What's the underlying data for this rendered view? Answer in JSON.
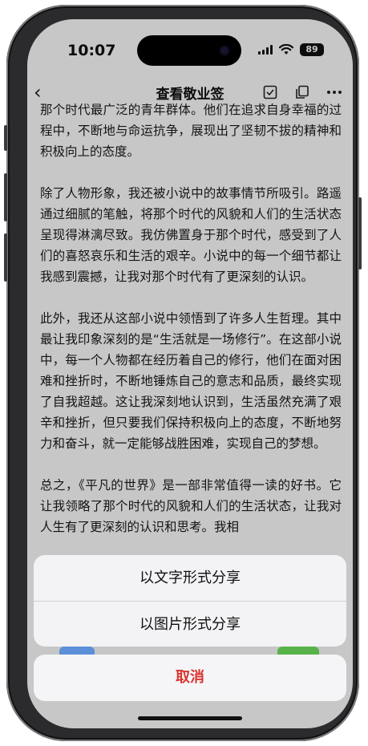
{
  "status_bar": {
    "time": "10:07",
    "battery": "89"
  },
  "nav": {
    "back_glyph": "‹",
    "title": "查看敬业签",
    "icons": [
      "check-square-icon",
      "copy-icon",
      "more-icon"
    ]
  },
  "article": {
    "paragraphs": [
      "那个时代最广泛的青年群体。他们在追求自身幸福的过程中，不断地与命运抗争，展现出了坚韧不拔的精神和积极向上的态度。",
      "除了人物形象，我还被小说中的故事情节所吸引。路遥通过细腻的笔触，将那个时代的风貌和人们的生活状态呈现得淋漓尽致。我仿佛置身于那个时代，感受到了人们的喜怒哀乐和生活的艰辛。小说中的每一个细节都让我感到震撼，让我对那个时代有了更深刻的认识。",
      "此外，我还从这部小说中领悟到了许多人生哲理。其中最让我印象深刻的是“生活就是一场修行”。在这部小说中，每一个人物都在经历着自己的修行，他们在面对困难和挫折时，不断地锤炼自己的意志和品质，最终实现了自我超越。这让我深刻地认识到，生活虽然充满了艰辛和挫折，但只要我们保持积极向上的态度，不断地努力和奋斗，就一定能够战胜困难，实现自己的梦想。",
      "总之，《平凡的世界》是一部非常值得一读的好书。它让我领略了那个时代的风貌和人们的生活状态，让我对人生有了更深刻的认识和思考。我相"
    ]
  },
  "share_sheet": {
    "options": [
      "以文字形式分享",
      "以图片形式分享"
    ],
    "cancel": "取消"
  },
  "colors": {
    "cancel_text": "#d8342f",
    "sheet_bg": "#f5f5f7"
  }
}
